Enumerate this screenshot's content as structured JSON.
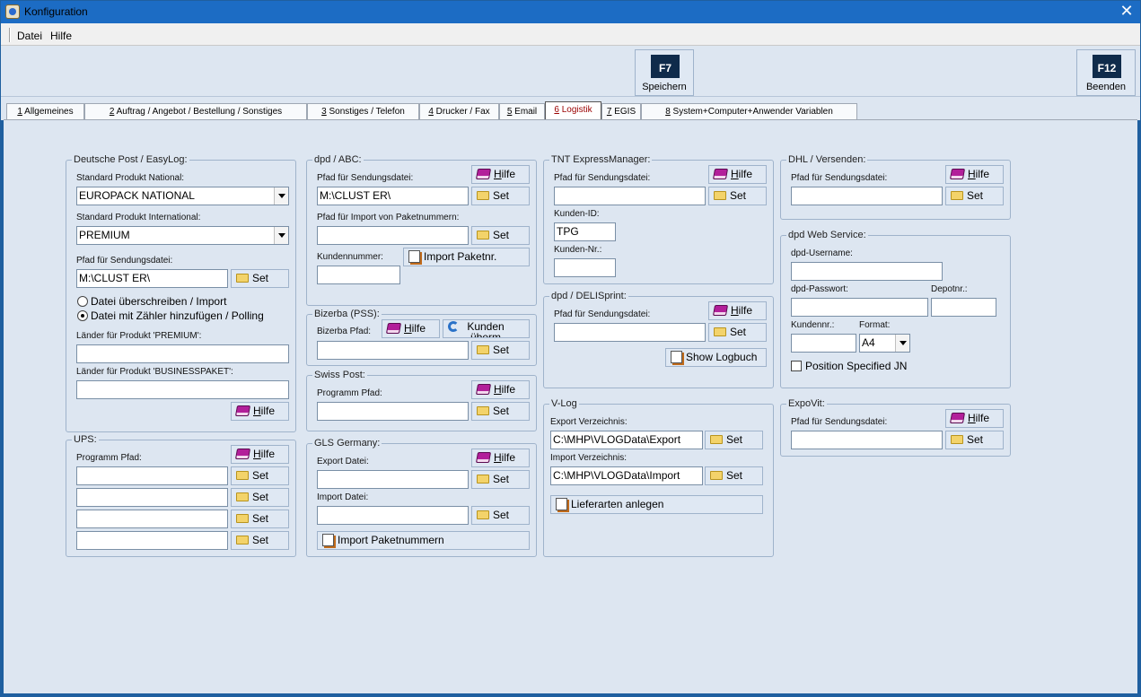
{
  "window": {
    "title": "Konfiguration",
    "close": "✕"
  },
  "menu": {
    "items": [
      "Datei",
      "Hilfe"
    ]
  },
  "toolbar": {
    "save": {
      "key": "F7",
      "label": "Speichern"
    },
    "exit": {
      "key": "F12",
      "label": "Beenden"
    }
  },
  "tabs": [
    {
      "num": "1",
      "label": " Allgemeines"
    },
    {
      "num": "2",
      "label": " Auftrag / Angebot / Bestellung / Sonstiges"
    },
    {
      "num": "3",
      "label": " Sonstiges / Telefon"
    },
    {
      "num": "4",
      "label": " Drucker / Fax"
    },
    {
      "num": "5",
      "label": " Email"
    },
    {
      "num": "6",
      "label": " Logistik"
    },
    {
      "num": "7",
      "label": " EGIS"
    },
    {
      "num": "8",
      "label": " System+Computer+Anwender Variablen"
    }
  ],
  "common": {
    "set": "Set",
    "hilfe_h": "H",
    "hilfe_rest": "ilfe"
  },
  "dp": {
    "title": "Deutsche Post / EasyLog:",
    "nat_label": "Standard Produkt National:",
    "nat_value": "EUROPACK NATIONAL",
    "int_label": "Standard Produkt International:",
    "int_value": "PREMIUM",
    "pfad_label": "Pfad für Sendungsdatei:",
    "pfad_value": "M:\\CLUST ER\\",
    "radio1": "Datei überschreiben / Import",
    "radio2": "Datei mit Zähler hinzufügen / Polling",
    "premium_label": "Länder für Produkt 'PREMIUM':",
    "premium_value": "",
    "business_label": "Länder für Produkt 'BUSINESSPAKET':",
    "business_value": ""
  },
  "ups": {
    "title": "UPS:",
    "pfad_label": "Programm Pfad:"
  },
  "dpd_abc": {
    "title": "dpd / ABC:",
    "pfad_label": "Pfad für Sendungsdatei:",
    "pfad_value": "M:\\CLUST ER\\",
    "import_label": "Pfad für Import von Paketnummern:",
    "kunden_label": "Kundennummer:",
    "import_btn": "Import Paketnr."
  },
  "bizerba": {
    "title": "Bizerba (PSS):",
    "pfad_label": "Bizerba Pfad:",
    "kunden_btn": "Kunden überm"
  },
  "swiss": {
    "title": "Swiss Post:",
    "pfad_label": "Programm Pfad:"
  },
  "gls": {
    "title": "GLS Germany:",
    "export_label": "Export Datei:",
    "import_label": "Import Datei:",
    "import_btn": "Import Paketnummern"
  },
  "tnt": {
    "title": "TNT ExpressManager:",
    "pfad_label": "Pfad für Sendungsdatei:",
    "kid_label": "Kunden-ID:",
    "kid_value": "TPG",
    "knr_label": "Kunden-Nr.:"
  },
  "deli": {
    "title": "dpd / DELISprint:",
    "pfad_label": "Pfad für Sendungsdatei:",
    "log_btn": "Show Logbuch"
  },
  "vlog": {
    "title": "V-Log",
    "export_label": "Export Verzeichnis:",
    "export_value": "C:\\MHP\\VLOGData\\Export",
    "import_label": "Import Verzeichnis:",
    "import_value": "C:\\MHP\\VLOGData\\Import",
    "lief_btn": "Lieferarten anlegen"
  },
  "dhl": {
    "title": "DHL / Versenden:",
    "pfad_label": "Pfad für Sendungsdatei:"
  },
  "dpdws": {
    "title": "dpd Web Service:",
    "user_label": "dpd-Username:",
    "pass_label": "dpd-Passwort:",
    "depot_label": "Depotnr.:",
    "kunden_label": "Kundennr.:",
    "format_label": "Format:",
    "format_value": "A4",
    "pos_label": "Position Specified JN"
  },
  "expovit": {
    "title": "ExpoVit:",
    "pfad_label": "Pfad für Sendungsdatei:"
  }
}
